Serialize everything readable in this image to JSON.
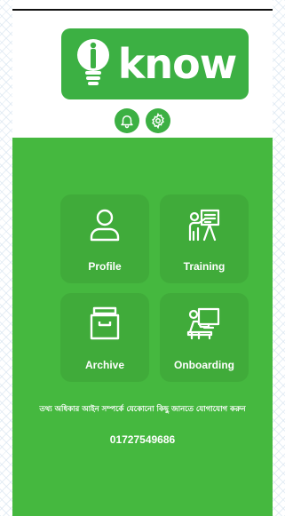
{
  "logo": {
    "text": "know"
  },
  "header_icons": [
    "bell-icon",
    "gear-icon"
  ],
  "menu": {
    "profile": {
      "label": "Profile",
      "icon": "user-icon"
    },
    "training": {
      "label": "Training",
      "icon": "presentation-icon"
    },
    "archive": {
      "label": "Archive",
      "icon": "archive-box-icon"
    },
    "onboarding": {
      "label": "Onboarding",
      "icon": "desk-computer-icon"
    }
  },
  "contact": {
    "text": "তথ্য অধিকার আইন সম্পর্কে যেকোনো কিছু জানতে যোগাযোগ করুন",
    "phone": "01727549686"
  },
  "colors": {
    "brand_green": "#3cb043",
    "panel_green": "#45b83f"
  }
}
